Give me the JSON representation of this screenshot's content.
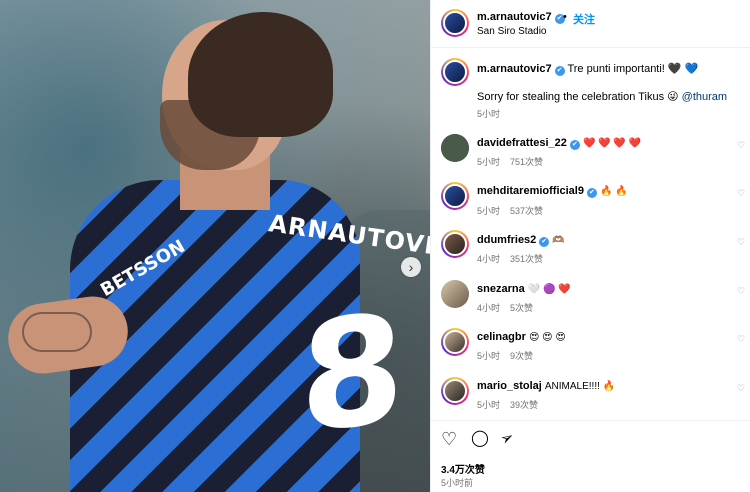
{
  "post": {
    "author": "m.arnautovic7",
    "follow_label": "关注",
    "dot": "•",
    "location": "San Siro Stadio",
    "caption_user": "m.arnautovic7",
    "caption_line1": "Tre punti importanti! 🖤 💙",
    "caption_line2_prefix": "Sorry for stealing the celebration Tikus 😜 ",
    "caption_mention": "@thuram",
    "caption_time": "5小时",
    "photo_print_name": "ARNAUTOVIĆ",
    "photo_number": "8",
    "photo_sponsor": "BETSSON",
    "next_arrow": "›"
  },
  "comments": [
    {
      "user": "davidefrattesi_22",
      "verified": true,
      "text": "❤️ ❤️ ❤️ ❤️",
      "time": "5小时",
      "likes": "751次赞"
    },
    {
      "user": "mehditaremiofficial9",
      "verified": true,
      "text": "🔥 🔥",
      "time": "5小时",
      "likes": "537次赞"
    },
    {
      "user": "ddumfries2",
      "verified": true,
      "text": "🫶🏽",
      "time": "4小时",
      "likes": "351次赞"
    },
    {
      "user": "snezarna",
      "verified": false,
      "text": "🤍 🟣 ❤️",
      "time": "4小时",
      "likes": "5次赞"
    },
    {
      "user": "celinagbr",
      "verified": false,
      "text": "😍 😍 😍",
      "time": "5小时",
      "likes": "9次赞"
    },
    {
      "user": "mario_stolaj",
      "verified": false,
      "text": "ANIMALE!!!! 🔥",
      "time": "5小时",
      "likes": "39次赞"
    }
  ],
  "footer": {
    "likes": "3.4万次赞",
    "time": "5小时前"
  },
  "icons": {
    "verified": "✔",
    "heart": "♡",
    "comment": "◯",
    "share": "➢"
  },
  "colors": {
    "accent": "#0095f6",
    "verified": "#3897f0"
  }
}
